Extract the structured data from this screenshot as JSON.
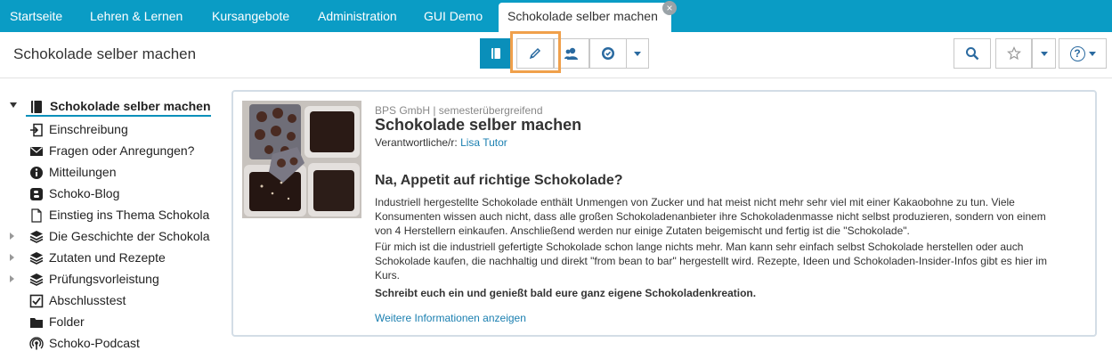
{
  "nav": {
    "tabs": [
      "Startseite",
      "Lehren & Lernen",
      "Kursangebote",
      "Administration",
      "GUI Demo"
    ],
    "active_tab": "Schokolade selber machen",
    "close_glyph": "×"
  },
  "toolbar": {
    "title": "Schokolade selber machen",
    "icons": [
      "book-icon",
      "pencil-icon",
      "users-icon",
      "badge-icon",
      "search-icon",
      "star-icon",
      "help-icon"
    ],
    "help_glyph": "?"
  },
  "tree": {
    "root": "Schokolade selber machen",
    "items": [
      {
        "label": "Einschreibung",
        "icon": "enroll-icon"
      },
      {
        "label": "Fragen oder Anregungen?",
        "icon": "mail-icon"
      },
      {
        "label": "Mitteilungen",
        "icon": "info-icon"
      },
      {
        "label": "Schoko-Blog",
        "icon": "blog-icon"
      },
      {
        "label": "Einstieg ins Thema Schokola",
        "icon": "page-icon"
      },
      {
        "label": "Die Geschichte der Schokola",
        "icon": "stack-icon"
      },
      {
        "label": "Zutaten und Rezepte",
        "icon": "stack-icon"
      },
      {
        "label": "Prüfungsvorleistung",
        "icon": "stack-icon"
      },
      {
        "label": "Abschlusstest",
        "icon": "checkbox-icon"
      },
      {
        "label": "Folder",
        "icon": "folder-icon"
      },
      {
        "label": "Schoko-Podcast",
        "icon": "podcast-icon"
      }
    ]
  },
  "course": {
    "meta": "BPS GmbH | semesterübergreifend",
    "title": "Schokolade selber machen",
    "responsible_label": "Verantwortliche/r:",
    "responsible_name": "Lisa Tutor",
    "headline": "Na, Appetit auf richtige Schokolade?",
    "p1": "Industriell hergestellte Schokolade enthält Unmengen von Zucker und hat meist nicht mehr sehr viel mit einer Kakaobohne zu tun. Viele Konsumenten wissen auch nicht, dass alle großen Schokoladenanbieter ihre Schokoladenmasse nicht selbst produzieren, sondern von einem von 4 Herstellern einkaufen. Anschließend werden nur einige Zutaten beigemischt und fertig ist die \"Schokolade\".",
    "p2": "Für mich ist die industriell gefertigte Schokolade schon lange nichts mehr. Man kann sehr einfach selbst Schokolade herstellen oder auch Schokolade kaufen, die nachhaltig und direkt \"from bean to bar\" hergestellt wird. Rezepte, Ideen und Schokoladen-Insider-Infos gibt es hier im Kurs.",
    "p3": "Schreibt euch ein und genießt bald eure ganz eigene Schokoladenkreation.",
    "more_link": "Weitere Informationen anzeigen"
  },
  "colors": {
    "nav_bg": "#0a9cc5",
    "primary": "#0a8fba",
    "highlight": "#f0a04b",
    "link": "#1a7fb0"
  }
}
